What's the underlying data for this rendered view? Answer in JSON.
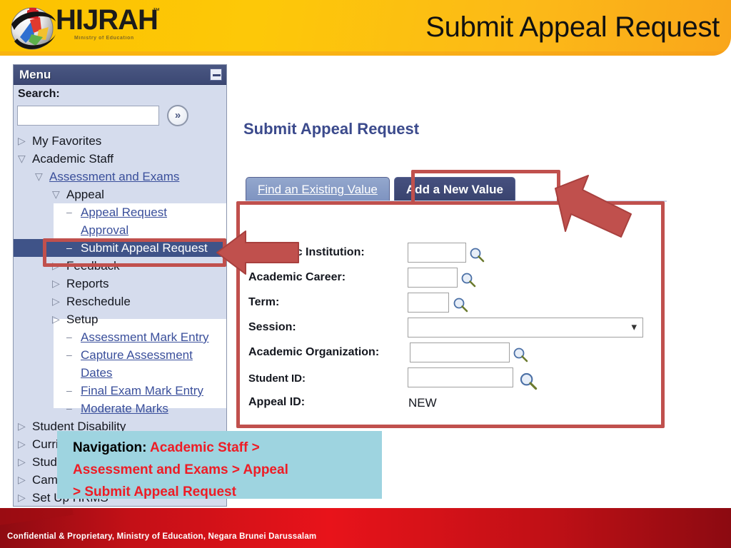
{
  "header": {
    "title": "Submit Appeal Request",
    "logo_word": "HIJRAH",
    "logo_tm": "™",
    "logo_tagline": "Ministry of Education",
    "logo_icon": "globe-sphere-logo"
  },
  "sidebar": {
    "title": "Menu",
    "collapse_icon": "minus-icon",
    "search_label": "Search:",
    "search_value": "",
    "search_placeholder": "",
    "search_go_icon": "double-chevron-right-icon",
    "items": [
      {
        "label": "My Favorites",
        "indent": 0,
        "marker": "collapsed-arrow",
        "style": "plain",
        "selected": false
      },
      {
        "label": "Academic Staff",
        "indent": 0,
        "marker": "expanded-arrow",
        "style": "plain",
        "selected": false
      },
      {
        "label": "Assessment and Exams",
        "indent": 1,
        "marker": "expanded-arrow",
        "style": "link",
        "selected": false
      },
      {
        "label": "Appeal",
        "indent": 2,
        "marker": "expanded-arrow",
        "style": "plain",
        "selected": false
      },
      {
        "label": "Appeal Request Approval",
        "indent": 3,
        "marker": "dash",
        "style": "link",
        "selected": false
      },
      {
        "label": "Submit Appeal Request",
        "indent": 3,
        "marker": "dash",
        "style": "selected",
        "selected": true
      },
      {
        "label": "Feedback",
        "indent": 2,
        "marker": "collapsed-arrow",
        "style": "plain",
        "selected": false
      },
      {
        "label": "Reports",
        "indent": 2,
        "marker": "collapsed-arrow",
        "style": "plain",
        "selected": false
      },
      {
        "label": "Reschedule",
        "indent": 2,
        "marker": "collapsed-arrow",
        "style": "plain",
        "selected": false
      },
      {
        "label": "Setup",
        "indent": 2,
        "marker": "collapsed-arrow",
        "style": "plain",
        "selected": false
      },
      {
        "label": "Assessment Mark Entry",
        "indent": 3,
        "marker": "dash",
        "style": "link",
        "selected": false
      },
      {
        "label": "Capture Assessment Dates",
        "indent": 3,
        "marker": "dash",
        "style": "link",
        "selected": false
      },
      {
        "label": "Final Exam Mark Entry",
        "indent": 3,
        "marker": "dash",
        "style": "link",
        "selected": false
      },
      {
        "label": "Moderate Marks",
        "indent": 3,
        "marker": "dash",
        "style": "link",
        "selected": false
      },
      {
        "label": "Student Disability",
        "indent": 0,
        "marker": "collapsed-arrow",
        "style": "plain",
        "selected": false
      },
      {
        "label": "Curriculum Management",
        "indent": 0,
        "marker": "collapsed-arrow",
        "style": "plain",
        "selected": false
      },
      {
        "label": "Student Records",
        "indent": 0,
        "marker": "collapsed-arrow",
        "style": "plain",
        "selected": false
      },
      {
        "label": "Campus Community",
        "indent": 0,
        "marker": "collapsed-arrow",
        "style": "plain",
        "selected": false
      },
      {
        "label": "Set Up HRMS",
        "indent": 0,
        "marker": "collapsed-arrow",
        "style": "plain",
        "selected": false
      }
    ]
  },
  "main": {
    "page_title": "Submit Appeal Request",
    "tabs": [
      {
        "label": "Find an Existing Value",
        "active": false,
        "accesskey": "F"
      },
      {
        "label": "Add a New Value",
        "active": true,
        "accesskey": ""
      }
    ],
    "fields": [
      {
        "label": "Academic Institution:",
        "type": "lookup",
        "value": ""
      },
      {
        "label": "Academic Career:",
        "type": "lookup",
        "value": ""
      },
      {
        "label": "Term:",
        "type": "lookup",
        "value": ""
      },
      {
        "label": "Session:",
        "type": "select",
        "value": ""
      },
      {
        "label": "Academic Organization:",
        "type": "lookup",
        "value": ""
      },
      {
        "label": "Student  ID:",
        "type": "lookup",
        "value": ""
      },
      {
        "label": "Appeal ID:",
        "type": "static",
        "value": "NEW"
      }
    ],
    "lookup_icon": "magnifier-icon",
    "select_icon": "chevron-down-icon"
  },
  "callout": {
    "prefix": "Navigation: ",
    "line1_red": "Academic Staff >",
    "line2_red": "Assessment and Exams > Appeal",
    "line3_red": "> Submit Appeal Request"
  },
  "annotations": {
    "highlight_tab": "add-a-new-value",
    "highlight_menu_item": "submit-appeal-request",
    "highlight_form_box": "add-new-value-form",
    "arrow_to_tab": "arrow-pointing-up-left",
    "arrow_to_menu": "arrow-pointing-left"
  },
  "footer": {
    "text": "Confidential & Proprietary, Ministry of Education, Negara Brunei Darussalam"
  },
  "colors": {
    "header_yellow": "#fcc200",
    "menu_navy": "#3c4874",
    "menu_bg": "#d5dced",
    "link_blue": "#3a4f9b",
    "title_blue": "#3b4a8c",
    "annotation_red": "#c0504d",
    "callout_bg": "#9ed4e0",
    "callout_red": "#ee1c25",
    "footer_red": "#e8131a"
  }
}
